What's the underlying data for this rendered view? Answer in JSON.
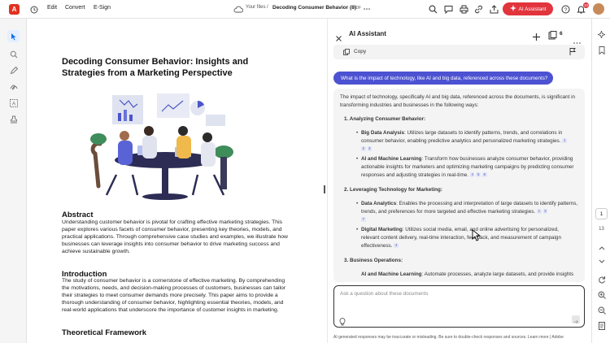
{
  "topbar": {
    "menu": [
      "Edit",
      "Convert",
      "E-Sign"
    ],
    "breadcrumb": "Your files",
    "separator": "/",
    "doc_title": "Decoding Consumer Behavior (8)",
    "doc_type": "PDF",
    "ai_button": "AI Assistant",
    "notifications": "10"
  },
  "document": {
    "title": "Decoding Consumer Behavior: Insights and Strategies from a Marketing Perspective",
    "sections": [
      {
        "heading": "Abstract",
        "body": "Understanding customer behavior is pivotal for crafting effective marketing strategies. This paper explores various facets of consumer behavior, presenting key theories, models, and practical applications. Through comprehensive case studies and examples, we illustrate how businesses can leverage insights into consumer behavior to drive marketing success and achieve sustainable growth."
      },
      {
        "heading": "Introduction",
        "body": "The study of consumer behavior is a cornerstone of effective marketing. By comprehending the motivations, needs, and decision-making processes of customers, businesses can tailor their strategies to meet consumer demands more precisely. This paper aims to provide a thorough understanding of consumer behavior, highlighting essential theories, models, and real-world applications that underscore the importance of customer insights in marketing."
      },
      {
        "heading": "Theoretical Framework",
        "body": ""
      }
    ]
  },
  "assistant": {
    "title": "AI Assistant",
    "source_count": "6",
    "copy_label": "Copy",
    "question": "What is the impact of technology, like AI and big data, referenced across these documents?",
    "answer_intro": "The impact of technology, specifically AI and big data, referenced across the documents, is significant in transforming industries and businesses in the following ways:",
    "groups": [
      {
        "title": "1.  Analyzing Consumer Behavior:",
        "items": [
          {
            "term": "Big Data Analysis",
            "text": ": Utilizes large datasets to identify patterns, trends, and correlations in consumer behavior, enabling predictive analytics and personalized marketing strategies.",
            "cites": [
              "1",
              "2",
              "3"
            ]
          },
          {
            "term": "AI and Machine Learning",
            "text": ": Transform how businesses analyze consumer behavior, providing actionable insights for marketers and optimizing marketing campaigns by predicting consumer responses and adjusting strategies in real-time.",
            "cites": [
              "4",
              "5",
              "6"
            ]
          }
        ]
      },
      {
        "title": "2.  Leveraging Technology for Marketing:",
        "items": [
          {
            "term": "Data Analytics",
            "text": ": Enables the processing and interpretation of large datasets to identify patterns, trends, and preferences for more targeted and effective marketing strategies.",
            "cites": [
              "1",
              "3",
              "7"
            ]
          },
          {
            "term": "Digital Marketing",
            "text": ": Utilizes social media, email, and online advertising for personalized, relevant content delivery, real-time interaction, feedback, and measurement of campaign effectiveness.",
            "cites": [
              "4"
            ]
          }
        ]
      },
      {
        "title": "3.  Business Operations:",
        "items": [
          {
            "term": "AI and Machine Learning",
            "text": ": Automate processes, analyze large datasets, and provide insights",
            "cites": []
          }
        ]
      }
    ],
    "input_placeholder": "Ask a question about these documents",
    "disclaimer": "AI generated responses may be inaccurate or misleading. Be sure to double-check responses and sources. Learn more | Adobe"
  },
  "pager": {
    "current": "1",
    "total": "13"
  },
  "colors": {
    "brand_red": "#e2343c",
    "accent_purple": "#4c52d1",
    "tool_active": "#1473e6"
  }
}
